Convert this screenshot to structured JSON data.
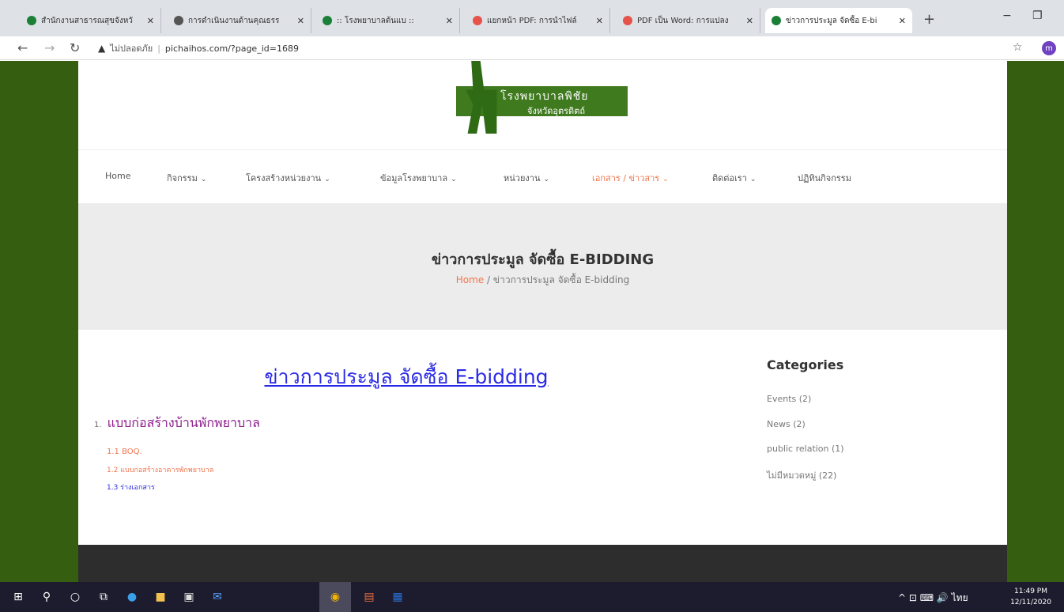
{
  "browser": {
    "tabs": [
      {
        "title": "สำนักงานสาธารณสุขจังหวั",
        "favicon_color": "#1a7f37"
      },
      {
        "title": "การดำเนินงานด้านคุณธรร",
        "favicon_color": "#555555"
      },
      {
        "title": ":: โรงพยาบาลต้นแบ ::",
        "favicon_color": "#1a7f37"
      },
      {
        "title": "แยกหน้า PDF: การนำไฟล์",
        "favicon_color": "#e5534b"
      },
      {
        "title": "PDF เป็น Word: การแปลง",
        "favicon_color": "#e5534b"
      },
      {
        "title": "ข่าวการประมูล จัดซื้อ E-bi",
        "favicon_color": "#1a7f37"
      }
    ],
    "new_tab": "+",
    "minimize": "−",
    "restore": "❐",
    "address": {
      "security": "ไม่ปลอดภัย",
      "url": "pichaihos.com/?page_id=1689"
    },
    "profile_initial": "m"
  },
  "site": {
    "logo_line1": "โรงพยาบาลพิชัย",
    "logo_line2": "จังหวัดอุตรดิตถ์",
    "menu": [
      {
        "label": "Home",
        "dropdown": false
      },
      {
        "label": "กิจกรรม",
        "dropdown": true
      },
      {
        "label": "โครงสร้างหน่วยงาน",
        "dropdown": true
      },
      {
        "label": "ข้อมูลโรงพยาบาล",
        "dropdown": true
      },
      {
        "label": "หน่วยงาน",
        "dropdown": true
      },
      {
        "label": "เอกสาร / ข่าวสาร",
        "dropdown": true,
        "active": true
      },
      {
        "label": "ติดต่อเรา",
        "dropdown": true
      },
      {
        "label": "ปฏิทินกิจกรรม",
        "dropdown": false
      }
    ],
    "hero": {
      "title": "ข่าวการประมูล จัดซื้อ E-BIDDING",
      "breadcrumb_home": "Home",
      "breadcrumb_sep": "/",
      "breadcrumb_current": "ข่าวการประมูล จัดซื้อ E-bidding"
    },
    "content": {
      "title": "ข่าวการประมูล จัดซื้อ E-bidding",
      "item_number": "1.",
      "item_title": "แบบก่อสร้างบ้านพักพยาบาล",
      "subitems": [
        "1.1 BOQ.",
        "1.2 แบบก่อสร้างอาคารพักพยาบาล",
        "1.3 ร่างเอกสาร"
      ]
    },
    "sidebar": {
      "heading": "Categories",
      "items": [
        "Events (2)",
        "News (2)",
        "public relation (1)",
        "ไม่มีหมวดหมู่ (22)"
      ]
    }
  },
  "taskbar": {
    "tray_lang": "ไทย",
    "time": "11:49 PM",
    "date": "12/11/2020"
  }
}
